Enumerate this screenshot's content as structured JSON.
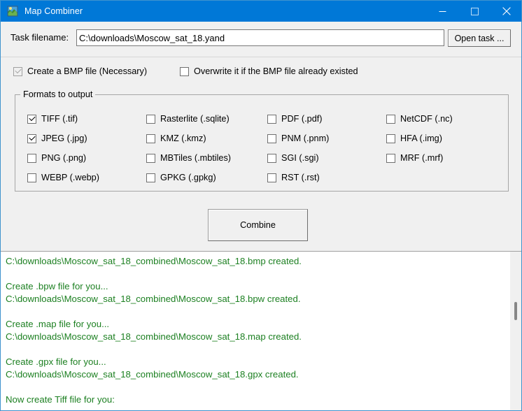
{
  "window": {
    "title": "Map Combiner",
    "icon": "map-globe-icon",
    "accent_color": "#0078d7",
    "border_color": "#3f93ce",
    "background_color": "#f0f0f0"
  },
  "titlebar_buttons": {
    "minimize": "minimize-icon",
    "maximize": "maximize-icon",
    "close": "close-icon"
  },
  "task": {
    "label": "Task filename:",
    "value": "C:\\downloads\\Moscow_sat_18.yand",
    "placeholder": "",
    "open_button": "Open task ..."
  },
  "top_options": [
    {
      "id": "create-bmp",
      "label": "Create a  BMP file (Necessary)",
      "checked": true,
      "disabled": true
    },
    {
      "id": "overwrite-bmp",
      "label": "Overwrite it if the BMP file already existed",
      "checked": false,
      "disabled": false
    }
  ],
  "formats_group": {
    "legend": "Formats to output",
    "columns": [
      [
        {
          "id": "tiff",
          "label": "TIFF (.tif)",
          "checked": true
        },
        {
          "id": "jpeg",
          "label": "JPEG (.jpg)",
          "checked": true
        },
        {
          "id": "png",
          "label": "PNG (.png)",
          "checked": false
        },
        {
          "id": "webp",
          "label": "WEBP (.webp)",
          "checked": false
        }
      ],
      [
        {
          "id": "rasterlite",
          "label": "Rasterlite (.sqlite)",
          "checked": false
        },
        {
          "id": "kmz",
          "label": "KMZ (.kmz)",
          "checked": false
        },
        {
          "id": "mbtiles",
          "label": "MBTiles (.mbtiles)",
          "checked": false
        },
        {
          "id": "gpkg",
          "label": "GPKG (.gpkg)",
          "checked": false
        }
      ],
      [
        {
          "id": "pdf",
          "label": "PDF (.pdf)",
          "checked": false
        },
        {
          "id": "pnm",
          "label": "PNM (.pnm)",
          "checked": false
        },
        {
          "id": "sgi",
          "label": "SGI (.sgi)",
          "checked": false
        },
        {
          "id": "rst",
          "label": "RST (.rst)",
          "checked": false
        }
      ],
      [
        {
          "id": "netcdf",
          "label": "NetCDF (.nc)",
          "checked": false
        },
        {
          "id": "hfa",
          "label": "HFA (.img)",
          "checked": false
        },
        {
          "id": "mrf",
          "label": "MRF (.mrf)",
          "checked": false
        }
      ]
    ]
  },
  "combine": {
    "label": "Combine"
  },
  "log": {
    "text_color": "#1d8022",
    "lines": [
      "C:\\downloads\\Moscow_sat_18_combined\\Moscow_sat_18.bmp created.",
      "",
      "Create .bpw file for you...",
      "C:\\downloads\\Moscow_sat_18_combined\\Moscow_sat_18.bpw created.",
      "",
      "Create .map file for you...",
      "C:\\downloads\\Moscow_sat_18_combined\\Moscow_sat_18.map created.",
      "",
      "Create .gpx file for you...",
      "C:\\downloads\\Moscow_sat_18_combined\\Moscow_sat_18.gpx created.",
      "",
      "Now create Tiff file for you:"
    ]
  }
}
